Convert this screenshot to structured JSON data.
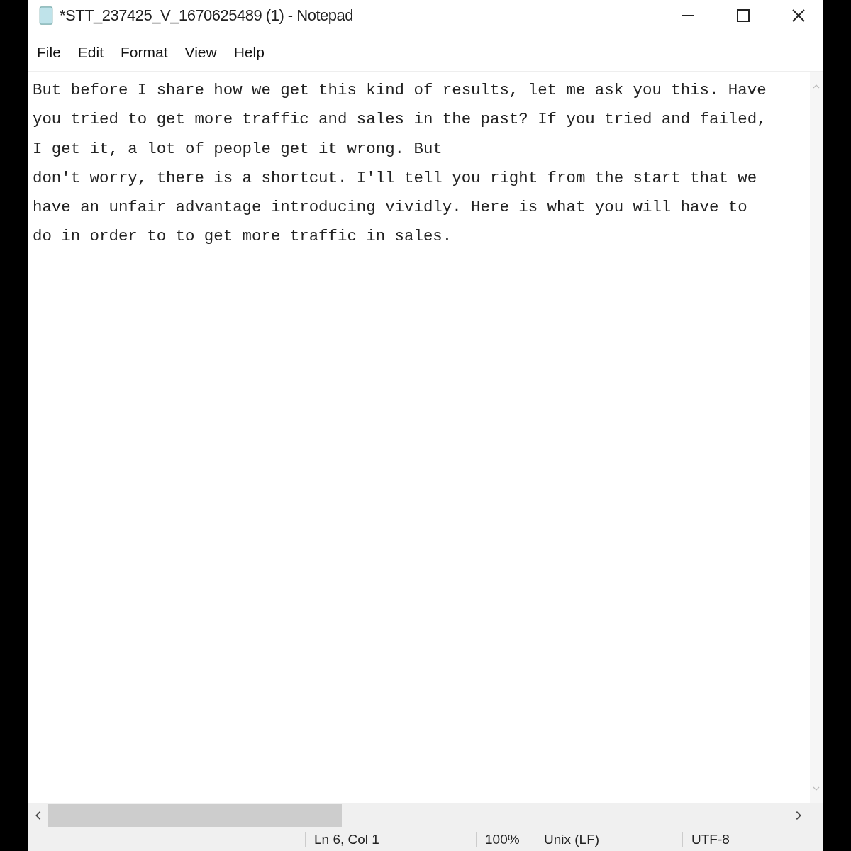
{
  "window": {
    "title": "*STT_237425_V_1670625489 (1) - Notepad"
  },
  "menu": [
    "File",
    "Edit",
    "Format",
    "View",
    "Help"
  ],
  "editor": {
    "lines": [
      "But before I share how we get this kind of results, let me ask you this. Have",
      "you tried to get more traffic and sales in the past? If you tried and failed,",
      "I get it, a lot of people get it wrong. But",
      "don't worry, there is a shortcut. I'll tell you right from the start that we",
      "have an unfair advantage introducing vividly. Here is what you will have to",
      "do in order to to get more traffic in sales."
    ]
  },
  "status_bar": [
    "Ln 6, Col 1",
    "100%",
    "Unix (LF)",
    "UTF-8"
  ]
}
